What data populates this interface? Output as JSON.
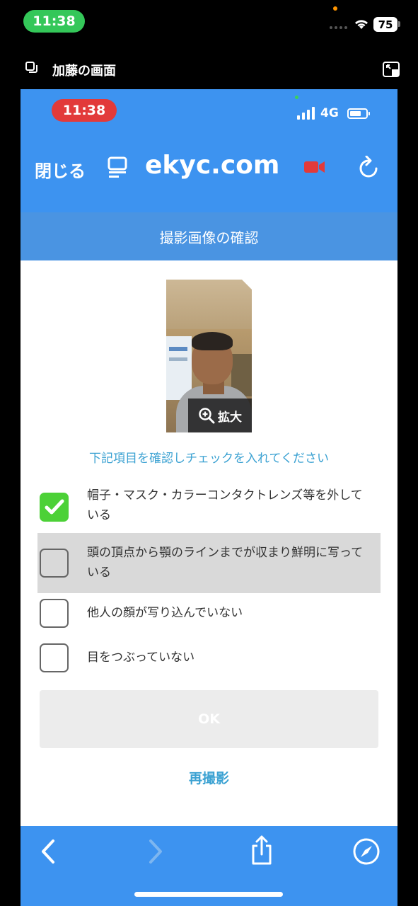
{
  "outer_status": {
    "time": "11:38",
    "battery": "75"
  },
  "share_bar": {
    "title": "加藤の画面"
  },
  "inner_status": {
    "time": "11:38",
    "network": "4G"
  },
  "browser": {
    "close_label": "閉じる",
    "url": "ekyc.com"
  },
  "page": {
    "header_title": "撮影画像の確認",
    "zoom_label": "拡大",
    "instruction": "下記項目を確認しチェックを入れてください",
    "checklist": [
      {
        "label": "帽子・マスク・カラーコンタクトレンズ等を外している",
        "checked": true
      },
      {
        "label": "頭の頂点から顎のラインまでが収まり鮮明に写っている",
        "checked": false
      },
      {
        "label": "他人の顔が写り込んでいない",
        "checked": false
      },
      {
        "label": "目をつぶっていない",
        "checked": false
      }
    ],
    "ok_label": "OK",
    "retake_label": "再撮影"
  },
  "colors": {
    "browser_blue": "#3d93f0",
    "header_blue": "#4a94e2",
    "link_blue": "#3aa1d2",
    "check_green": "#4cd137",
    "recording_red": "#e23a3a",
    "outer_time_green": "#34c759"
  },
  "icons": {
    "share_screen": "screen-share-icon",
    "expand": "expand-icon",
    "reader": "reader-mode-icon",
    "camera": "video-camera-icon",
    "reload": "reload-icon",
    "zoom": "zoom-in-icon",
    "back": "chevron-left-icon",
    "forward": "chevron-right-icon",
    "share": "share-icon",
    "compass": "compass-icon"
  }
}
